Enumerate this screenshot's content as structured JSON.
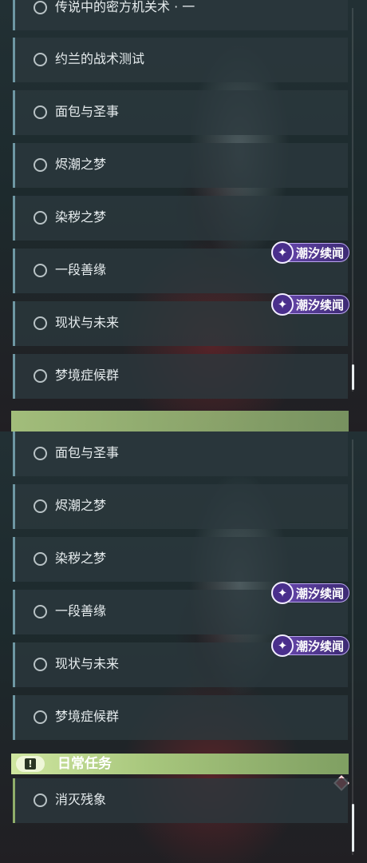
{
  "top_panel": {
    "tasks": [
      {
        "label": "传说中的密方机关术 · 一",
        "badge": ""
      },
      {
        "label": "约兰的战术测试",
        "badge": ""
      },
      {
        "label": "面包与圣事",
        "badge": ""
      },
      {
        "label": "烬潮之梦",
        "badge": ""
      },
      {
        "label": "染秽之梦",
        "badge": ""
      },
      {
        "label": "一段善缘",
        "badge": "潮汐续闻"
      },
      {
        "label": "现状与未来",
        "badge": "潮汐续闻"
      },
      {
        "label": "梦境症候群",
        "badge": ""
      }
    ]
  },
  "bottom_panel": {
    "tasks": [
      {
        "label": "面包与圣事",
        "badge": ""
      },
      {
        "label": "烬潮之梦",
        "badge": ""
      },
      {
        "label": "染秽之梦",
        "badge": ""
      },
      {
        "label": "一段善缘",
        "badge": "潮汐续闻"
      },
      {
        "label": "现状与未来",
        "badge": "潮汐续闻"
      },
      {
        "label": "梦境症候群",
        "badge": ""
      }
    ],
    "daily_section": {
      "title": "日常任务",
      "icon": "exclamation-icon",
      "tasks": [
        {
          "label": "消灭残象"
        }
      ]
    }
  },
  "colors": {
    "accent_blue": "#6e97a3",
    "daily_green": "#a8c77d",
    "badge_purple": "#6e4bb5",
    "alert_red": "#d94a5a"
  },
  "icons": {
    "radio": "radio-circle-icon",
    "badge": "tidal-news-icon",
    "alert": "red-diamond-icon"
  }
}
